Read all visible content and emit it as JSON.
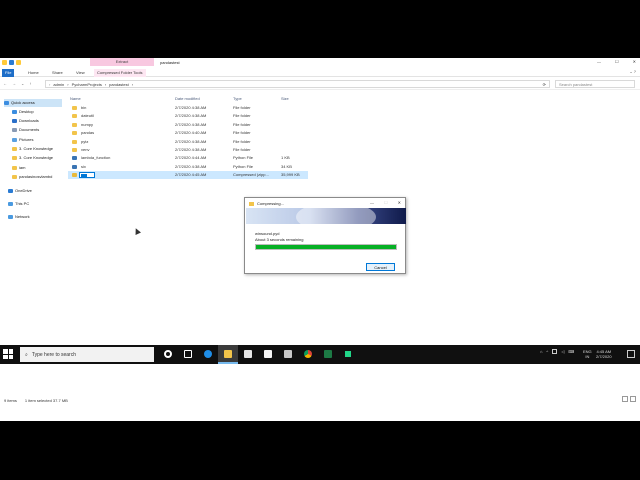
{
  "window": {
    "title": "pandastest",
    "context_tab": "Extract",
    "min": "—",
    "max": "☐",
    "close": "✕"
  },
  "ribbon": {
    "tabs": [
      "File",
      "Home",
      "Share",
      "View",
      "Compressed Folder Tools"
    ],
    "help_icon": "help-icon"
  },
  "address": {
    "path": [
      "admin",
      "PycharmProjects",
      "pandastest"
    ],
    "search_placeholder": "Search pandastest"
  },
  "nav": {
    "quick_access": "Quick access",
    "items": [
      "Desktop",
      "Downloads",
      "Documents",
      "Pictures",
      "3. Core Knowledge",
      "3. Core Knowledge",
      "iam",
      "pandasinosvlambd"
    ],
    "onedrive": "OneDrive",
    "thispc": "This PC",
    "network": "Network"
  },
  "files": {
    "headers": [
      "Name",
      "Date modified",
      "Type",
      "Size"
    ],
    "rows": [
      {
        "name": "bin",
        "date": "2/7/2020 4:38 AM",
        "type": "File folder",
        "size": "",
        "kind": "folder"
      },
      {
        "name": "dateutil",
        "date": "2/7/2020 4:38 AM",
        "type": "File folder",
        "size": "",
        "kind": "folder"
      },
      {
        "name": "numpy",
        "date": "2/7/2020 4:38 AM",
        "type": "File folder",
        "size": "",
        "kind": "folder"
      },
      {
        "name": "pandas",
        "date": "2/7/2020 4:40 AM",
        "type": "File folder",
        "size": "",
        "kind": "folder"
      },
      {
        "name": "pytz",
        "date": "2/7/2020 4:38 AM",
        "type": "File folder",
        "size": "",
        "kind": "folder"
      },
      {
        "name": "venv",
        "date": "2/7/2020 4:38 AM",
        "type": "File folder",
        "size": "",
        "kind": "folder"
      },
      {
        "name": "lambda_function",
        "date": "2/7/2020 4:44 AM",
        "type": "Python File",
        "size": "1 KB",
        "kind": "python"
      },
      {
        "name": "six",
        "date": "2/7/2020 4:38 AM",
        "type": "Python File",
        "size": "34 KB",
        "kind": "python"
      },
      {
        "name": "",
        "date": "2/7/2020 4:45 AM",
        "type": "Compressed (zipp...",
        "size": "35,999 KB",
        "kind": "zip"
      }
    ]
  },
  "status": {
    "count": "9 items",
    "selected": "1 item selected  37.7 MB"
  },
  "dialog": {
    "title": "Compressing...",
    "filename": "winsound.pyd",
    "remaining": "About 3 seconds remaining",
    "progress": 1.0,
    "cancel": "Cancel"
  },
  "taskbar": {
    "search_placeholder": "Type here to search",
    "lang_top": "ENG",
    "lang_bottom": "IN",
    "time": "4:45 AM",
    "date": "2/7/2020"
  },
  "colors": {
    "progress": "#06b025",
    "accent": "#0078d7",
    "selection": "#cce8ff"
  }
}
